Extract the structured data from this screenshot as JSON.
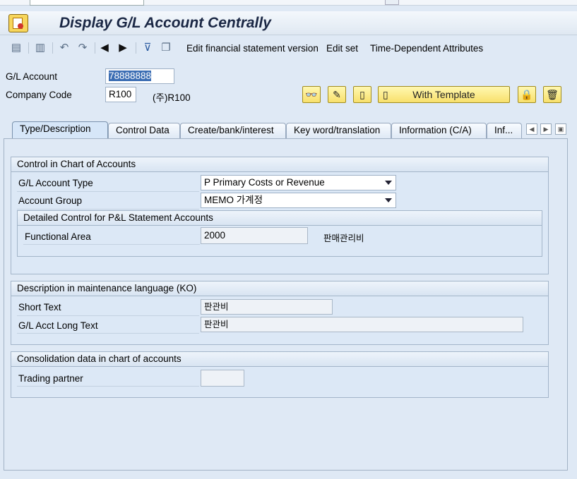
{
  "window": {
    "title": "Display G/L Account Centrally"
  },
  "toolbar": {
    "edit_fs_version": "Edit financial statement version",
    "edit_set": "Edit set",
    "time_dependent": "Time-Dependent Attributes"
  },
  "header": {
    "gl_account_label": "G/L Account",
    "gl_account_value": "78888888",
    "company_code_label": "Company Code",
    "company_code_value": "R100",
    "company_name": "(주)R100",
    "with_template": "With Template"
  },
  "tabs": [
    {
      "label": "Type/Description"
    },
    {
      "label": "Control Data"
    },
    {
      "label": "Create/bank/interest"
    },
    {
      "label": "Key word/translation"
    },
    {
      "label": "Information (C/A)"
    },
    {
      "label": "Inf..."
    }
  ],
  "control_coa": {
    "title": "Control in Chart of Accounts",
    "gl_type_label": "G/L Account Type",
    "gl_type_value": "P Primary Costs or Revenue",
    "account_group_label": "Account Group",
    "account_group_value": "MEMO 가계정",
    "pl_title": "Detailed Control for P&L Statement Accounts",
    "functional_area_label": "Functional Area",
    "functional_area_value": "2000",
    "functional_area_text": "판매관리비"
  },
  "description": {
    "title": "Description in maintenance language (KO)",
    "short_text_label": "Short Text",
    "short_text_value": "판관비",
    "long_text_label": "G/L Acct Long Text",
    "long_text_value": "판관비"
  },
  "consolidation": {
    "title": "Consolidation data in chart of accounts",
    "trading_partner_label": "Trading partner",
    "trading_partner_value": ""
  }
}
